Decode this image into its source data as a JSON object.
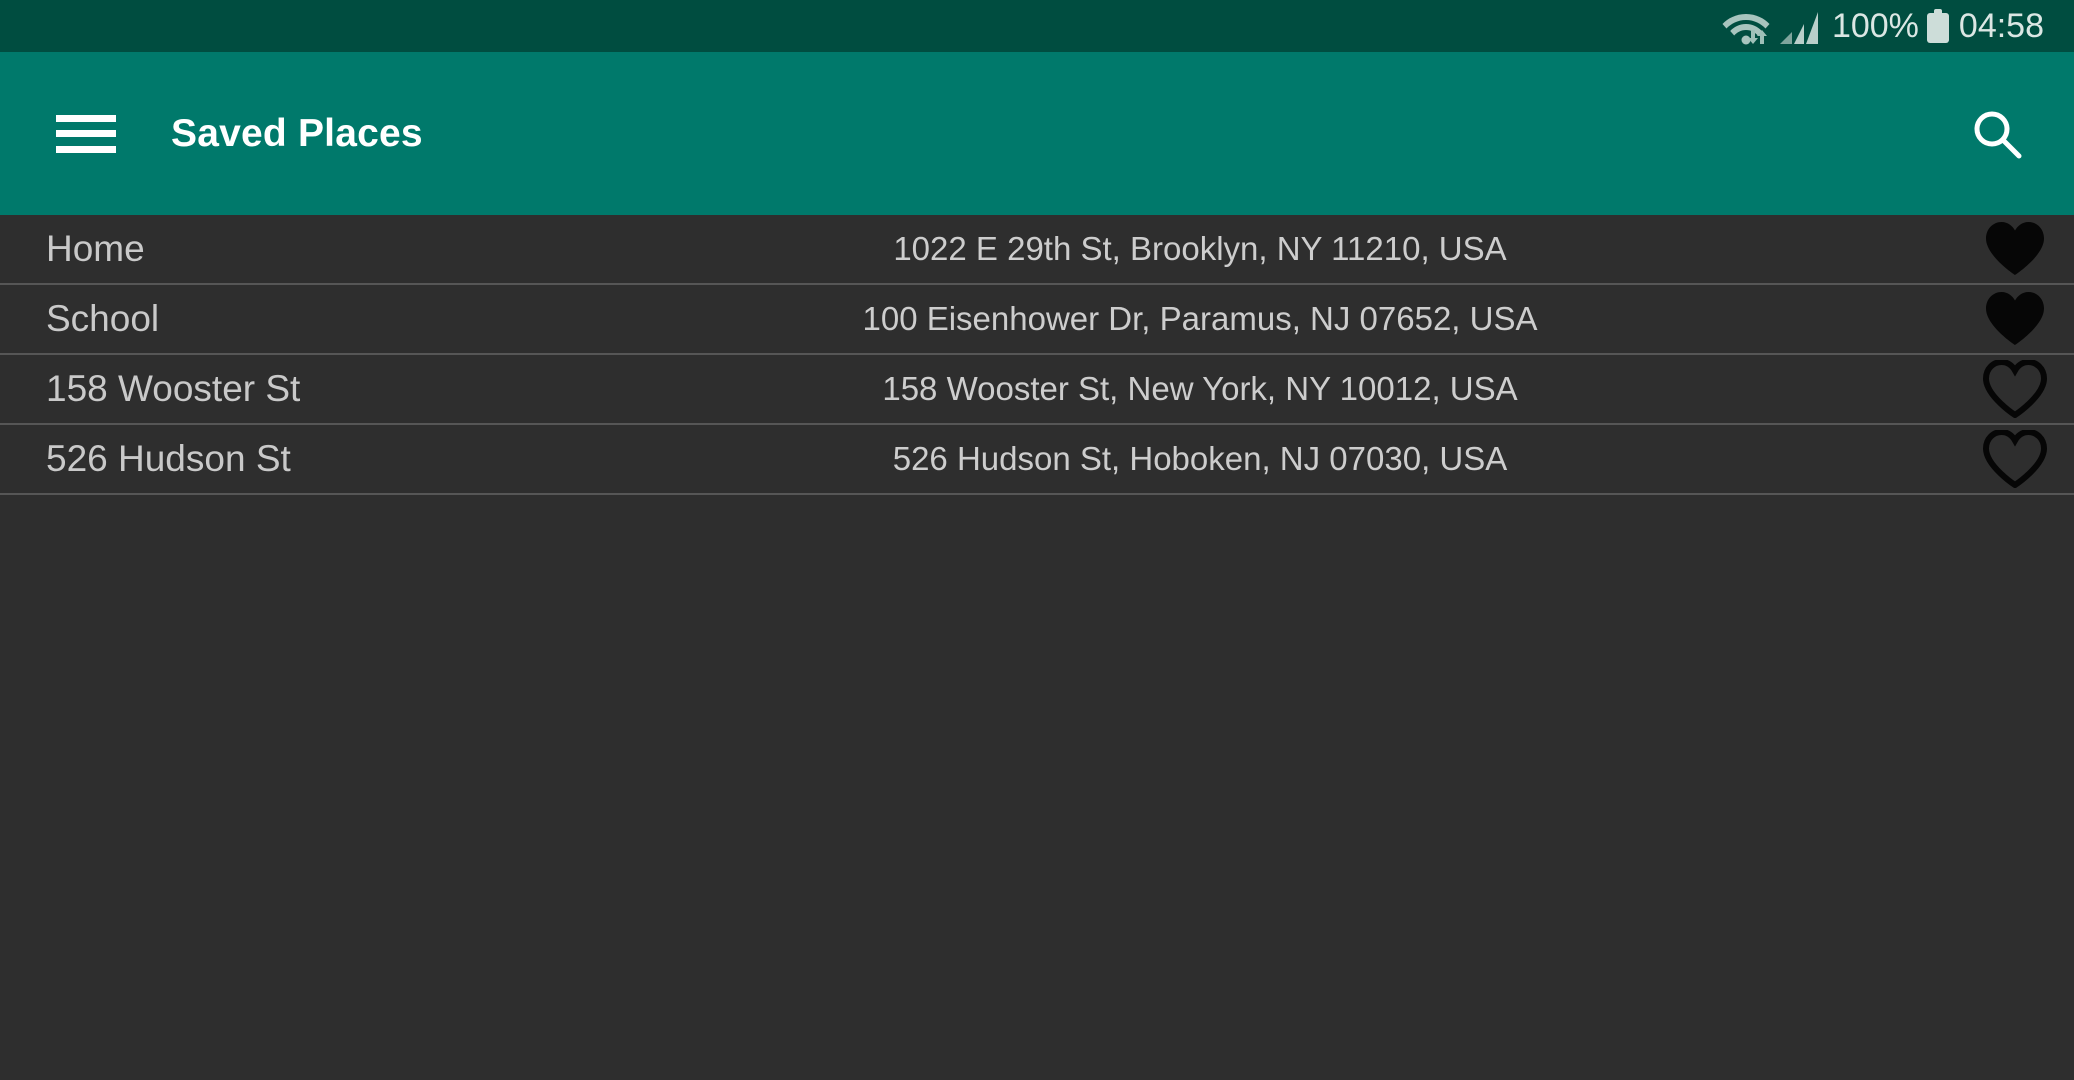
{
  "status_bar": {
    "background": "#004d40",
    "wifi_icon": "wifi-with-transfer-arrows",
    "signal_icon": "cellular-signal-bars",
    "battery_percent": "100%",
    "battery_icon": "battery-full",
    "clock": "04:58"
  },
  "app_bar": {
    "background": "#00796b",
    "menu_icon": "hamburger-menu-icon",
    "title": "Saved Places",
    "search_icon": "search-icon"
  },
  "list": {
    "background": "#2e2e2e",
    "divider_color": "#565656",
    "rows": [
      {
        "name": "Home",
        "address": "1022 E 29th St, Brooklyn, NY 11210, USA",
        "favorite": true,
        "favorite_icon": "heart-filled-icon"
      },
      {
        "name": "School",
        "address": "100 Eisenhower Dr, Paramus, NJ 07652, USA",
        "favorite": true,
        "favorite_icon": "heart-filled-icon"
      },
      {
        "name": "158 Wooster St",
        "address": "158 Wooster St, New York, NY 10012, USA",
        "favorite": false,
        "favorite_icon": "heart-outline-icon"
      },
      {
        "name": "526 Hudson St",
        "address": "526 Hudson St, Hoboken, NJ 07030, USA",
        "favorite": false,
        "favorite_icon": "heart-outline-icon"
      }
    ]
  }
}
